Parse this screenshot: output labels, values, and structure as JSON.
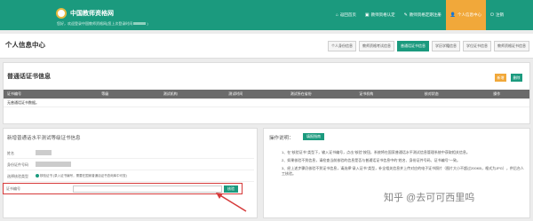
{
  "header": {
    "logo_text": "中国教师资格网",
    "welcome_prefix": "您好，欢迎登录中国教师资格网(您上次登录时间",
    "welcome_suffix": ")",
    "nav": [
      {
        "icon": "home-icon",
        "glyph": "⌂",
        "label": "返回首页",
        "active": false
      },
      {
        "icon": "info-icon",
        "glyph": "▣",
        "label": "教师资格认定",
        "active": false
      },
      {
        "icon": "edit-icon",
        "glyph": "✎",
        "label": "教师资格定期注册",
        "active": false
      },
      {
        "icon": "user-icon",
        "glyph": "👤",
        "label": "个人信息中心",
        "active": true
      },
      {
        "icon": "power-icon",
        "glyph": "⏻",
        "label": "注销",
        "active": false
      }
    ]
  },
  "profile": {
    "title": "个人信息中心",
    "tabs": [
      "个人身份信息",
      "教师资格考试信息",
      "普通话证书信息",
      "学历学籍信息",
      "学位证书信息",
      "教师资格证书信息"
    ],
    "active_tab": 2
  },
  "cert_section": {
    "title": "普通话证书信息",
    "add_label": "新增",
    "delete_label": "删除",
    "columns": [
      "证书编号",
      "等级",
      "测试机构",
      "测试时间",
      "测试所在省份",
      "证书机构",
      "核对状态",
      "操作"
    ],
    "empty_text": "无普通话证书数据。"
  },
  "form": {
    "title": "新增普通话水平测试等级证书信息",
    "name_label": "姓名",
    "id_label": "身份证件号码",
    "query_type_label": "选择核验类型",
    "radio_options": [
      {
        "label": "核验证书 (录入证书编号，需要在国家普通话证书查询库中可查)",
        "checked": true
      },
      {
        "label": "补录证书 (需要人工审核)",
        "checked": false
      }
    ],
    "cert_no_label": "证书编号",
    "cert_no_value": "",
    "cert_no_placeholder": "",
    "query_label": "核验"
  },
  "help": {
    "title": "操作说明：",
    "button_label": "填报指南",
    "items": [
      "1、在\"核验证书\"类型下，输入证书编号，点击\"核验\"按钮，系统将在国家普通话水平测试信息管理系统中获取相关信息。",
      "2、如果核验不到信息，请检查当前核验的信息是否与普通话证书信息中的\"姓名、身份证件号码、证书编号\"一致。",
      "3、经上述步骤仍核验不到证书信息，请选择\"录入证书\"类型，补全相关信息并上传对应的电子证书照片（图片大小不超过200KB，格式为JPG），供后台人工核验。"
    ]
  },
  "watermark": "知乎 @去可可西里呜",
  "colors": {
    "brand": "#1b9a7e",
    "accent": "#f1a83a",
    "highlight": "#d63a3a"
  }
}
